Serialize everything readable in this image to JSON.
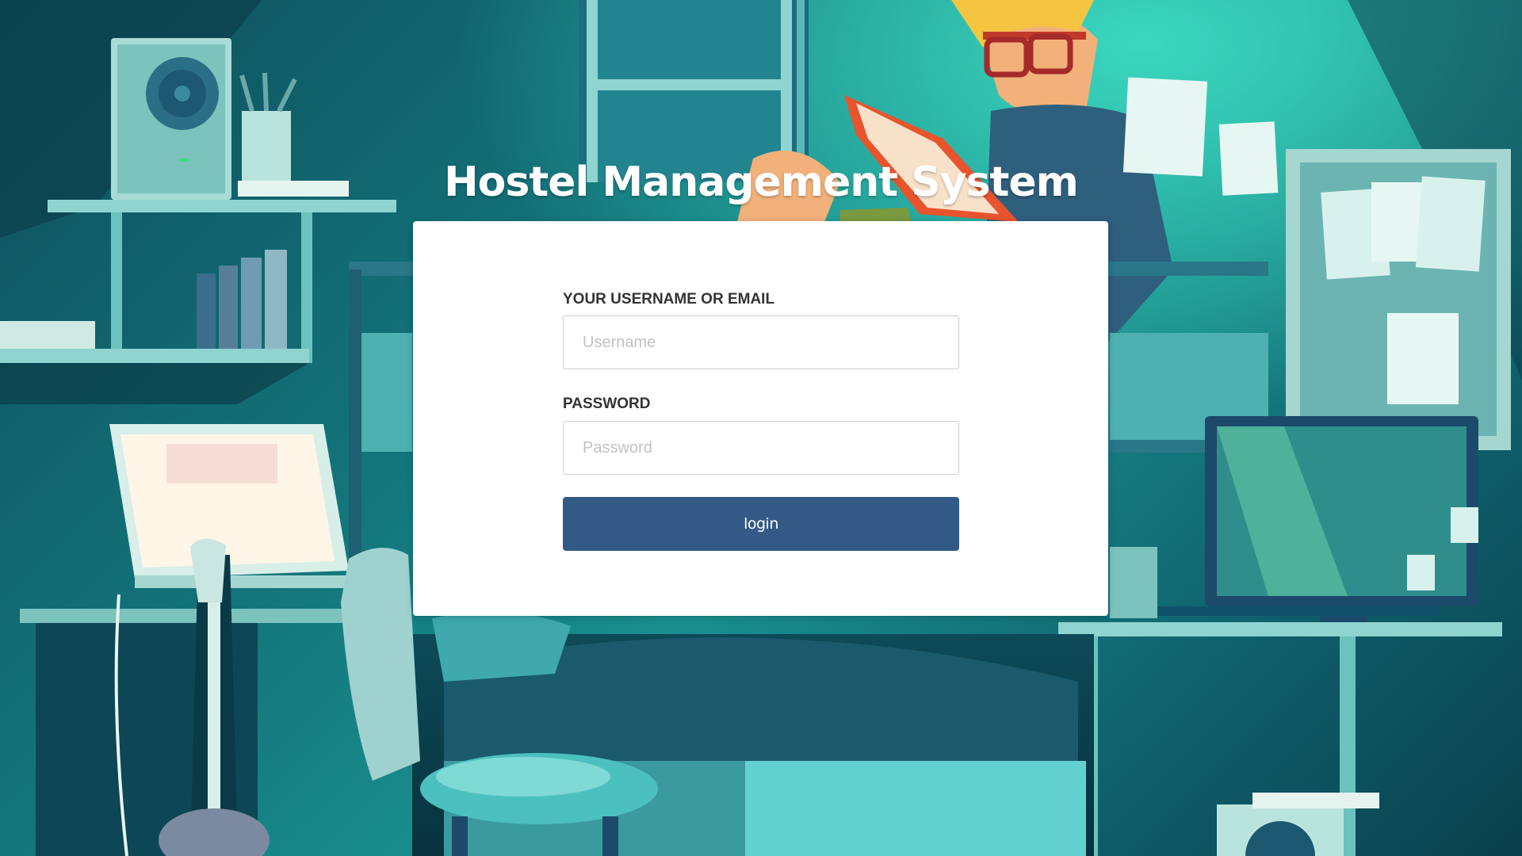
{
  "page": {
    "title": "Hostel Management System"
  },
  "login_form": {
    "username_label": "YOUR USERNAME OR EMAIL",
    "username_placeholder": "Username",
    "username_value": "",
    "password_label": "PASSWORD",
    "password_placeholder": "Password",
    "password_value": "",
    "submit_label": "login"
  },
  "colors": {
    "button": "#335a86",
    "card": "#ffffff",
    "background_teal": "#13747a"
  },
  "background": {
    "illustration": "dorm-room-student-reading-illustration"
  }
}
